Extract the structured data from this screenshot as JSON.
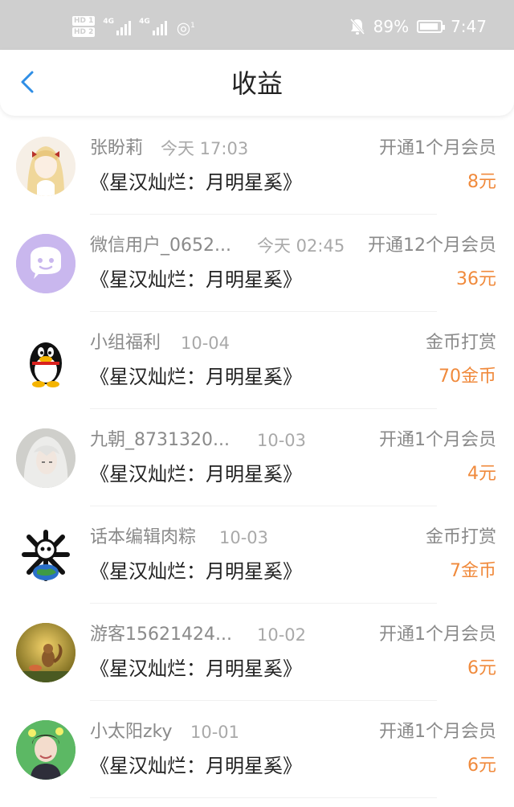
{
  "status_bar": {
    "hd1": "HD 1",
    "hd2": "HD 2",
    "signal1_label": "4G",
    "signal2_label": "4G",
    "wifi_badge": "1",
    "battery": "89%",
    "time": "7:47"
  },
  "header": {
    "title": "收益",
    "back_icon": "chevron-left-icon",
    "accent": "#2f8ee6"
  },
  "colors": {
    "amount": "#f08a3c",
    "status_bg": "#cfcfcf"
  },
  "records": [
    {
      "name": "张盼莉",
      "time": "今天 17:03",
      "type": "开通1个月会员",
      "book": "《星汉灿烂：月明星奚》",
      "amount": "8元",
      "avatar": "anime-girl-avatar"
    },
    {
      "name": "微信用户_0652...",
      "time": "今天 02:45",
      "type": "开通12个月会员",
      "book": "《星汉灿烂：月明星奚》",
      "amount": "36元",
      "avatar": "wechat-default-avatar"
    },
    {
      "name": "小组福利",
      "time": "10-04",
      "type": "金币打赏",
      "book": "《星汉灿烂：月明星奚》",
      "amount": "70金币",
      "avatar": "qq-penguin-avatar"
    },
    {
      "name": "九朝_8731320...",
      "time": "10-03",
      "type": "开通1个月会员",
      "book": "《星汉灿烂：月明星奚》",
      "amount": "4元",
      "avatar": "white-hair-character-avatar"
    },
    {
      "name": "话本编辑肉粽",
      "time": "10-03",
      "type": "金币打赏",
      "book": "《星汉灿烂：月明星奚》",
      "amount": "7金币",
      "avatar": "skull-globe-avatar"
    },
    {
      "name": "游客15621424...",
      "time": "10-02",
      "type": "开通1个月会员",
      "book": "《星汉灿烂：月明星奚》",
      "amount": "6元",
      "avatar": "squirrel-avatar"
    },
    {
      "name": "小太阳zky",
      "time": "10-01",
      "type": "开通1个月会员",
      "book": "《星汉灿烂：月明星奚》",
      "amount": "6元",
      "avatar": "young-man-avatar"
    }
  ]
}
